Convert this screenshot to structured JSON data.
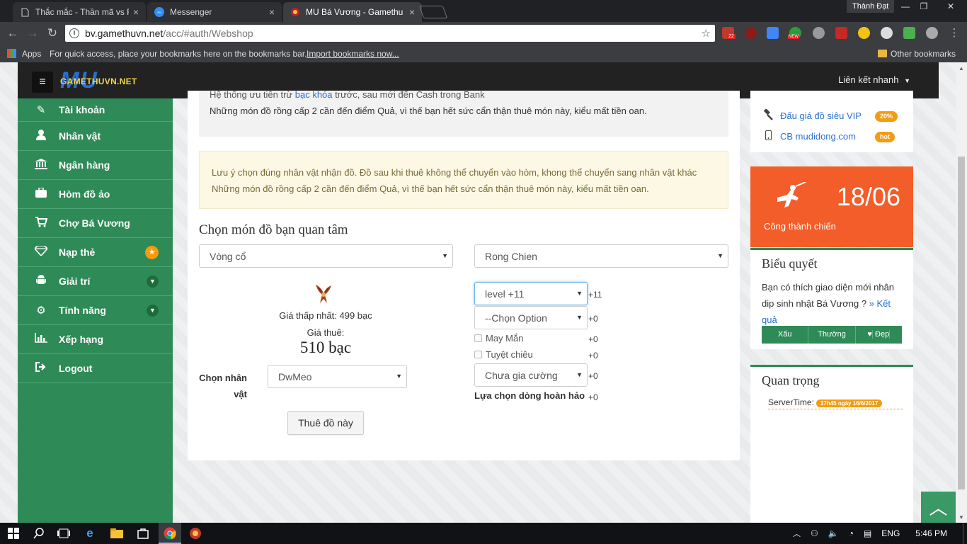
{
  "browser": {
    "tabs": [
      {
        "title": "Thắc mắc - Thần mã vs R",
        "icon": "document-icon",
        "active": false
      },
      {
        "title": "Messenger",
        "icon": "messenger-icon",
        "active": false
      },
      {
        "title": "MU Bá Vương - Gamethu",
        "icon": "mu-icon",
        "active": true
      }
    ],
    "profile": "Thành Đạt",
    "url_host": "bv.gamethuvn.net",
    "url_path": "/acc/#auth/Webshop",
    "extension_badge": "22",
    "extension_new": "NEW",
    "bookmarks": {
      "apps": "Apps",
      "quick": "For quick access, place your bookmarks here on the bookmarks bar.",
      "import": "Import bookmarks now...",
      "other": "Other bookmarks"
    }
  },
  "site": {
    "logo_mu": "MU",
    "logo_text": "GAMETHUVN.NET",
    "quick_link": "Liên kết nhanh"
  },
  "sidebar": {
    "items": [
      {
        "label": "Tài khoản",
        "icon": "edit-icon"
      },
      {
        "label": "Nhân vật",
        "icon": "user-icon"
      },
      {
        "label": "Ngân hàng",
        "icon": "bank-icon"
      },
      {
        "label": "Hòm đồ ảo",
        "icon": "briefcase-icon"
      },
      {
        "label": "Chợ Bá Vương",
        "icon": "cart-icon"
      },
      {
        "label": "Nạp thẻ",
        "icon": "diamond-icon"
      },
      {
        "label": "Giải trí",
        "icon": "android-icon"
      },
      {
        "label": "Tính năng",
        "icon": "cogs-icon"
      },
      {
        "label": "Xếp hạng",
        "icon": "bar-chart-icon"
      },
      {
        "label": "Logout",
        "icon": "logout-icon"
      }
    ]
  },
  "main": {
    "note_line1_pre": "Hệ thống ưu tiên trừ ",
    "note_line1_link": "bạc khóa",
    "note_line1_post": " trước, sau mới đến Cash trong Bank",
    "note_line2": "Những món đồ rồng cấp 2 cần đến điểm Quả, vì thế bạn hết sức cẩn thận thuê món này, kiểu mất tiền oan.",
    "warn_line1": "Lưu ý chọn đúng nhân vật nhận đồ. Đồ sau khi thuê không thể chuyển vào hòm, khong thể chuyển sang nhân vật khác",
    "warn_line2": "Những món đồ rồng cấp 2 cần đến điểm Quả, vì thế bạn hết sức cẩn thận thuê món này, kiểu mất tiền oan.",
    "section_title": "Chọn món đồ bạn quan tâm",
    "category_select": "Vòng cổ",
    "item_select": "Rong Chien",
    "min_price": "Giá thấp nhất: 499 bạc",
    "rent_price_label": "Giá thuê:",
    "rent_price": "510 bạc",
    "character_label_1": "Chọn nhân",
    "character_label_2": "vật",
    "character_select": "DwMeo",
    "rent_button": "Thuê đồ này",
    "level_select": "level +11",
    "level_plus": "+11",
    "option_select": "--Chọn Option",
    "option_plus": "+0",
    "luck_label": "May Mắn",
    "luck_plus": "+0",
    "skill_label": "Tuyệt chiêu",
    "skill_plus": "+0",
    "enhance_select": "Chưa gia cường",
    "enhance_plus": "+0",
    "perfect_label": "Lựa chọn dòng hoàn hảo",
    "perfect_plus": "+0"
  },
  "right": {
    "links": [
      {
        "label": "Đấu giá đồ siêu VIP",
        "tag": "20%",
        "icon": "gavel-icon"
      },
      {
        "label": "CB mudidong.com",
        "tag": "hot",
        "icon": "mobile-icon"
      }
    ],
    "event_date": "18/06",
    "event_name": "Công thành chiến",
    "poll_title": "Biểu quyết",
    "poll_question": "Bạn có thích giao diện mới nhân dip sinh nhật Bá Vương ?",
    "poll_result": "» Kết quả",
    "poll_options": [
      "Xấu",
      "Thường",
      "Đẹp"
    ],
    "important_title": "Quan trọng",
    "server_time_label": "ServerTime:",
    "server_time_value": "17h45 ngày 16/6/2017"
  },
  "taskbar": {
    "language": "ENG",
    "clock": "5:46 PM"
  },
  "colors": {
    "sidebar_green": "#2e8b57",
    "event_orange": "#f25d2a",
    "badge_orange": "#f39c12",
    "link_blue": "#2a6fd0"
  }
}
